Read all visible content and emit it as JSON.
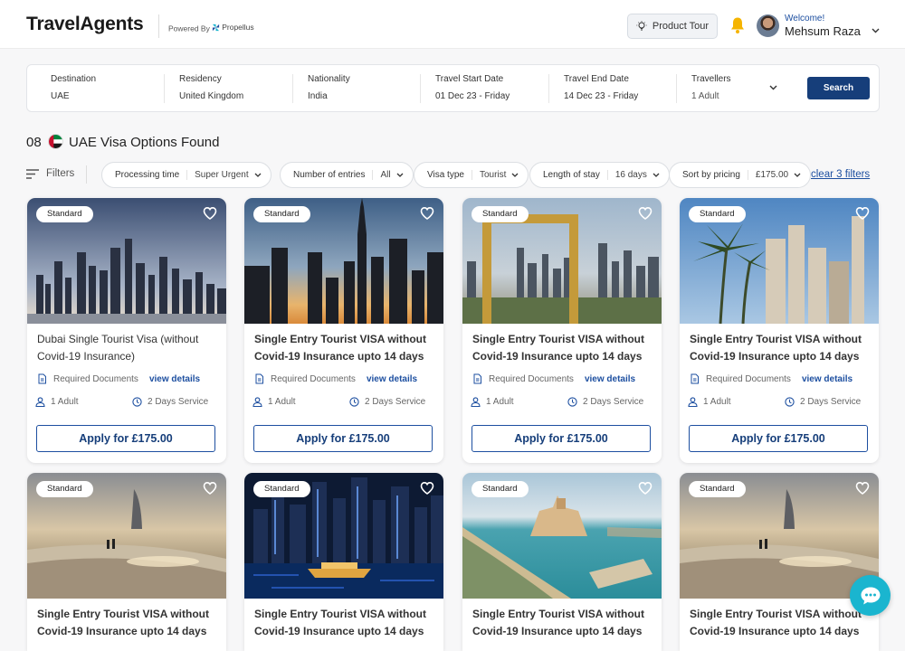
{
  "header": {
    "logo": "TravelAgents",
    "powered_by": "Powered By",
    "powered_brand": "Propellus",
    "product_tour": "Product Tour",
    "welcome": "Welcome!",
    "user_name": "Mehsum Raza"
  },
  "search": {
    "fields": [
      {
        "label": "Destination",
        "value": "UAE"
      },
      {
        "label": "Residency",
        "value": "United Kingdom"
      },
      {
        "label": "Nationality",
        "value": "India"
      },
      {
        "label": "Travel Start Date",
        "value": "01 Dec 23 - Friday"
      },
      {
        "label": "Travel End Date",
        "value": "14 Dec 23 - Friday"
      },
      {
        "label": "Travellers",
        "value": "1 Adult"
      }
    ],
    "button": "Search"
  },
  "results": {
    "count": "08",
    "title": "UAE Visa Options Found"
  },
  "filters": {
    "label": "Filters",
    "chips": [
      {
        "label": "Processing time",
        "value": "Super Urgent"
      },
      {
        "label": "Number of entries",
        "value": "All"
      },
      {
        "label": "Visa type",
        "value": "Tourist"
      },
      {
        "label": "Length of stay",
        "value": "16 days"
      },
      {
        "label": "Sort by pricing",
        "value": "£175.00"
      }
    ],
    "clear": "clear 3 filters"
  },
  "cards": [
    {
      "badge": "Standard",
      "title": "Dubai Single Tourist Visa (without Covid-19 Insurance)",
      "docs": "Required Documents",
      "view": "view details",
      "travellers": "1 Adult",
      "service": "2 Days Service",
      "apply": "Apply for £175.00"
    },
    {
      "badge": "Standard",
      "title": "Single Entry Tourist VISA without Covid-19 Insurance upto 14 days",
      "docs": "Required Documents",
      "view": "view details",
      "travellers": "1 Adult",
      "service": "2 Days Service",
      "apply": "Apply for £175.00"
    },
    {
      "badge": "Standard",
      "title": "Single Entry Tourist VISA without Covid-19 Insurance upto 14 days",
      "docs": "Required Documents",
      "view": "view details",
      "travellers": "1 Adult",
      "service": "2 Days Service",
      "apply": "Apply for £175.00"
    },
    {
      "badge": "Standard",
      "title": "Single Entry Tourist VISA without Covid-19 Insurance upto 14 days",
      "docs": "Required Documents",
      "view": "view details",
      "travellers": "1 Adult",
      "service": "2 Days Service",
      "apply": "Apply for £175.00"
    },
    {
      "badge": "Standard",
      "title": "Single Entry Tourist VISA without Covid-19 Insurance upto 14 days"
    },
    {
      "badge": "Standard",
      "title": "Single Entry Tourist VISA without Covid-19 Insurance upto 14 days"
    },
    {
      "badge": "Standard",
      "title": "Single Entry Tourist VISA without Covid-19 Insurance upto 14 days"
    },
    {
      "badge": "Standard",
      "title": "Single Entry Tourist VISA without Covid-19 Insurance upto 14 days"
    }
  ],
  "colors": {
    "primary": "#163e7a",
    "link": "#1d4fa0",
    "bell": "#f5b400",
    "chat": "#1ab5cf"
  }
}
